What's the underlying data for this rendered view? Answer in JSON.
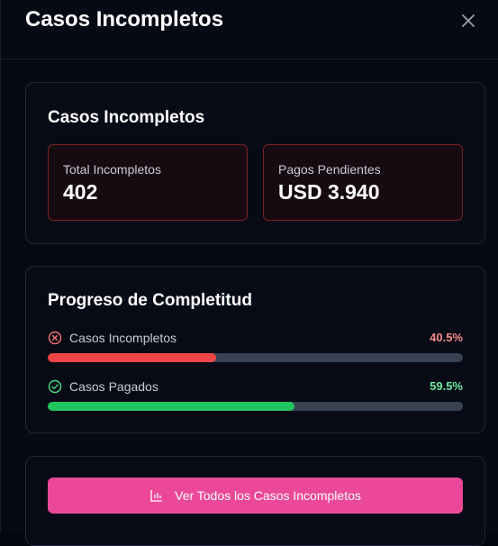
{
  "modal": {
    "title": "Casos Incompletos"
  },
  "summary": {
    "title": "Casos Incompletos",
    "stats": [
      {
        "label": "Total Incompletos",
        "value": "402"
      },
      {
        "label": "Pagos Pendientes",
        "value": "USD 3.940"
      }
    ]
  },
  "progress": {
    "title": "Progreso de Completitud",
    "items": [
      {
        "label": "Casos Incompletos",
        "percent_text": "40.5%",
        "percent": 40.5,
        "icon": "x-circle-icon",
        "color": "#ef4444"
      },
      {
        "label": "Casos Pagados",
        "percent_text": "59.5%",
        "percent": 59.5,
        "icon": "check-circle-icon",
        "color": "#22c55e"
      }
    ]
  },
  "actions": {
    "view_all_label": "Ver Todos los Casos Incompletos",
    "view_all_icon": "bar-chart-icon",
    "accent": "#ec4899"
  }
}
